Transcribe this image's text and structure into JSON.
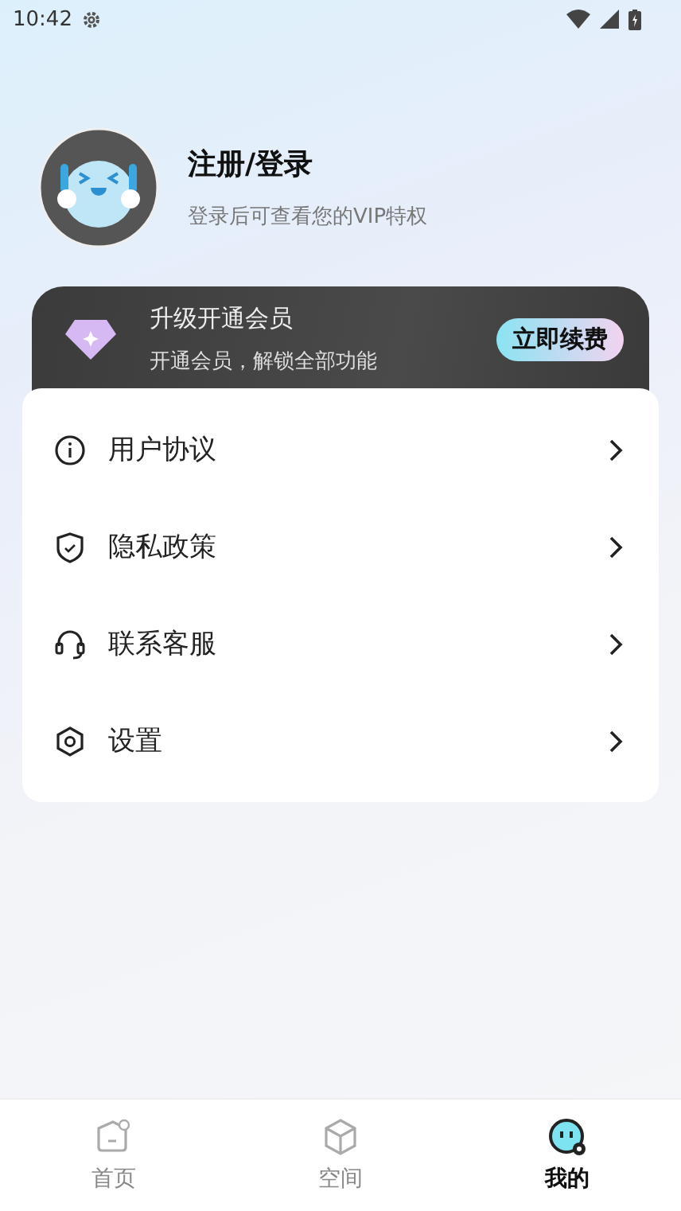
{
  "status_bar": {
    "time": "10:42"
  },
  "profile": {
    "title": "注册/登录",
    "subtitle": "登录后可查看您的VIP特权"
  },
  "vip_banner": {
    "title": "升级开通会员",
    "subtitle": "开通会员，解锁全部功能",
    "button": "立即续费"
  },
  "menu": [
    {
      "kind": "info",
      "label": "用户协议"
    },
    {
      "kind": "shield",
      "label": "隐私政策"
    },
    {
      "kind": "headset",
      "label": "联系客服"
    },
    {
      "kind": "settings",
      "label": "设置"
    }
  ],
  "tabs": [
    {
      "kind": "home",
      "label": "首页",
      "selected": false
    },
    {
      "kind": "space",
      "label": "空间",
      "selected": false
    },
    {
      "kind": "me",
      "label": "我的",
      "selected": true
    }
  ]
}
